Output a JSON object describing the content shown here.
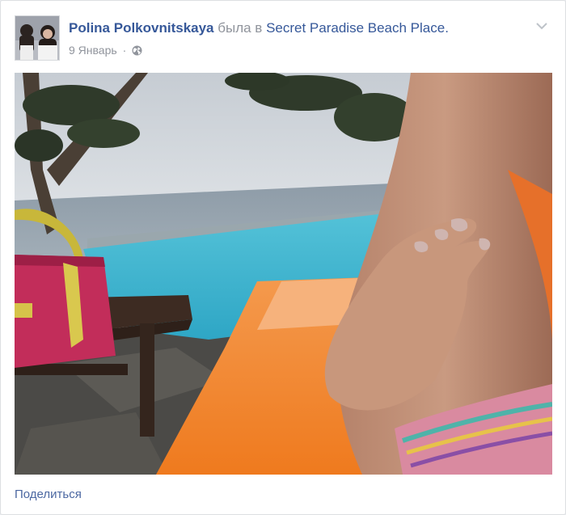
{
  "post": {
    "author_name": "Polina Polkovnitskaya",
    "verb": "была в",
    "place_name": "Secret Paradise Beach Place",
    "punctuation": ".",
    "date": "9 Январь",
    "separator": "·",
    "privacy_icon": "globe-icon",
    "menu_icon": "chevron-down-icon",
    "photo_description_icon": "photo"
  },
  "actions": {
    "share_label": "Поделиться"
  },
  "colors": {
    "link": "#365899",
    "meta": "#90949c",
    "share": "#4b67a1"
  }
}
